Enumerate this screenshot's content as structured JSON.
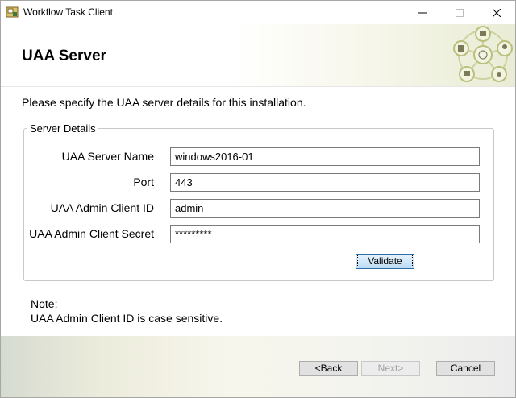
{
  "window": {
    "title": "Workflow Task Client",
    "minimize_label": "—",
    "maximize_label": "☐",
    "close_label": "✕"
  },
  "header": {
    "title": "UAA Server"
  },
  "intro": "Please specify the UAA server details for this installation.",
  "group": {
    "legend": "Server Details",
    "fields": [
      {
        "label": "UAA Server Name",
        "value": "windows2016-01"
      },
      {
        "label": "Port",
        "value": "443"
      },
      {
        "label": "UAA Admin Client ID",
        "value": "admin"
      },
      {
        "label": "UAA Admin Client Secret",
        "value": "*********"
      }
    ],
    "validate_label": "Validate"
  },
  "note": {
    "title": "Note:",
    "text": "UAA Admin Client ID is case sensitive."
  },
  "footer": {
    "back_label": "<Back",
    "next_label": "Next>",
    "cancel_label": "Cancel",
    "next_enabled": false
  },
  "colors": {
    "banner_accent": "#e9ecd5",
    "validate_border": "#2f6fa8",
    "disabled_text": "#a0a0a0"
  }
}
